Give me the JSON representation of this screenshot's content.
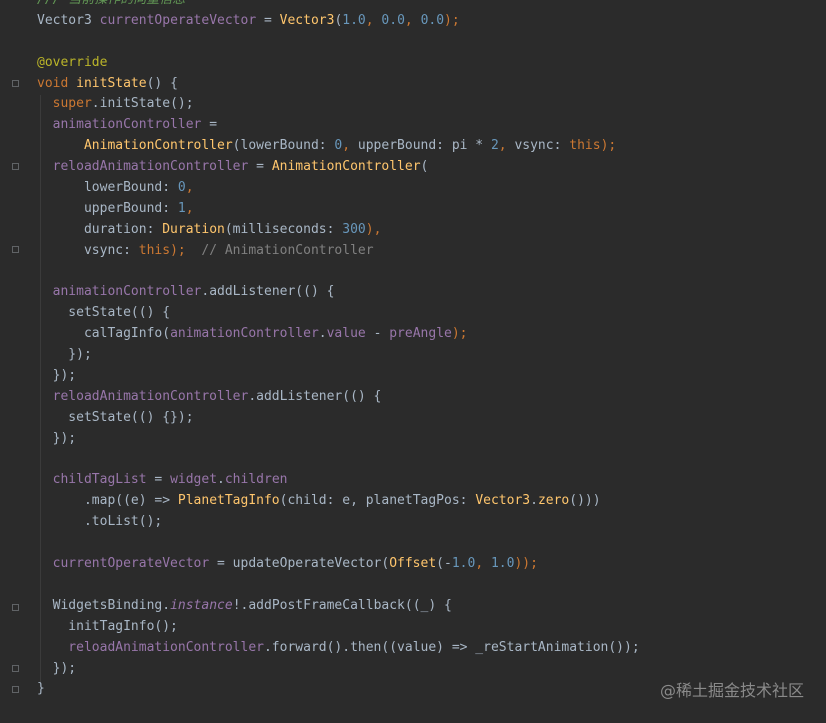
{
  "lines": [
    [
      {
        "t": "/// 当前操作的向量信息",
        "c": "c-comment"
      }
    ],
    [
      {
        "t": "Vector3 ",
        "c": "plain"
      },
      {
        "t": "currentOperateVector",
        "c": "field"
      },
      {
        "t": " = ",
        "c": "plain"
      },
      {
        "t": "Vector3",
        "c": "cls"
      },
      {
        "t": "(",
        "c": "plain"
      },
      {
        "t": "1.0",
        "c": "num"
      },
      {
        "t": ", ",
        "c": "kw"
      },
      {
        "t": "0.0",
        "c": "num"
      },
      {
        "t": ", ",
        "c": "kw"
      },
      {
        "t": "0.0",
        "c": "num"
      },
      {
        "t": ");",
        "c": "kw"
      }
    ],
    [],
    [
      {
        "t": "@override",
        "c": "ann"
      }
    ],
    [
      {
        "t": "void ",
        "c": "kw"
      },
      {
        "t": "initState",
        "c": "fn"
      },
      {
        "t": "() {",
        "c": "plain"
      }
    ],
    [
      {
        "t": "  super",
        "c": "kw"
      },
      {
        "t": ".initState();",
        "c": "plain"
      }
    ],
    [
      {
        "t": "  animationController",
        "c": "field"
      },
      {
        "t": " =",
        "c": "plain"
      }
    ],
    [
      {
        "t": "      AnimationController",
        "c": "cls"
      },
      {
        "t": "(lowerBound: ",
        "c": "plain"
      },
      {
        "t": "0",
        "c": "num"
      },
      {
        "t": ", ",
        "c": "kw"
      },
      {
        "t": "upperBound: pi * ",
        "c": "plain"
      },
      {
        "t": "2",
        "c": "num"
      },
      {
        "t": ", ",
        "c": "kw"
      },
      {
        "t": "vsync: ",
        "c": "plain"
      },
      {
        "t": "this",
        "c": "kw"
      },
      {
        "t": ");",
        "c": "kw"
      }
    ],
    [
      {
        "t": "  reloadAnimationController",
        "c": "field"
      },
      {
        "t": " = ",
        "c": "plain"
      },
      {
        "t": "AnimationController",
        "c": "cls"
      },
      {
        "t": "(",
        "c": "plain"
      }
    ],
    [
      {
        "t": "      lowerBound: ",
        "c": "plain"
      },
      {
        "t": "0",
        "c": "num"
      },
      {
        "t": ",",
        "c": "kw"
      }
    ],
    [
      {
        "t": "      upperBound: ",
        "c": "plain"
      },
      {
        "t": "1",
        "c": "num"
      },
      {
        "t": ",",
        "c": "kw"
      }
    ],
    [
      {
        "t": "      duration: ",
        "c": "plain"
      },
      {
        "t": "Duration",
        "c": "cls"
      },
      {
        "t": "(milliseconds: ",
        "c": "plain"
      },
      {
        "t": "300",
        "c": "num"
      },
      {
        "t": "),",
        "c": "kw"
      }
    ],
    [
      {
        "t": "      vsync: ",
        "c": "plain"
      },
      {
        "t": "this",
        "c": "kw"
      },
      {
        "t": ");",
        "c": "kw"
      },
      {
        "t": "  // AnimationController",
        "c": "c-comment2"
      }
    ],
    [],
    [
      {
        "t": "  animationController",
        "c": "field"
      },
      {
        "t": ".addListener(() {",
        "c": "plain"
      }
    ],
    [
      {
        "t": "    setState(() {",
        "c": "plain"
      }
    ],
    [
      {
        "t": "      calTagInfo(",
        "c": "plain"
      },
      {
        "t": "animationController",
        "c": "field"
      },
      {
        "t": ".",
        "c": "plain"
      },
      {
        "t": "value",
        "c": "field"
      },
      {
        "t": " - ",
        "c": "plain"
      },
      {
        "t": "preAngle",
        "c": "field"
      },
      {
        "t": ");",
        "c": "kw"
      }
    ],
    [
      {
        "t": "    });",
        "c": "plain"
      }
    ],
    [
      {
        "t": "  });",
        "c": "plain"
      }
    ],
    [
      {
        "t": "  reloadAnimationController",
        "c": "field"
      },
      {
        "t": ".addListener(() {",
        "c": "plain"
      }
    ],
    [
      {
        "t": "    setState(() {});",
        "c": "plain"
      }
    ],
    [
      {
        "t": "  });",
        "c": "plain"
      }
    ],
    [],
    [
      {
        "t": "  childTagList",
        "c": "field"
      },
      {
        "t": " = ",
        "c": "plain"
      },
      {
        "t": "widget",
        "c": "field"
      },
      {
        "t": ".",
        "c": "plain"
      },
      {
        "t": "children",
        "c": "field"
      }
    ],
    [
      {
        "t": "      .map((e) => ",
        "c": "plain"
      },
      {
        "t": "PlanetTagInfo",
        "c": "cls"
      },
      {
        "t": "(child: e, planetTagPos: ",
        "c": "plain"
      },
      {
        "t": "Vector3",
        "c": "cls"
      },
      {
        "t": ".",
        "c": "plain"
      },
      {
        "t": "zero",
        "c": "fn"
      },
      {
        "t": "()))",
        "c": "plain"
      }
    ],
    [
      {
        "t": "      .toList();",
        "c": "plain"
      }
    ],
    [],
    [
      {
        "t": "  currentOperateVector",
        "c": "field"
      },
      {
        "t": " = updateOperateVector(",
        "c": "plain"
      },
      {
        "t": "Offset",
        "c": "cls"
      },
      {
        "t": "(-",
        "c": "plain"
      },
      {
        "t": "1.0",
        "c": "num"
      },
      {
        "t": ", ",
        "c": "kw"
      },
      {
        "t": "1.0",
        "c": "num"
      },
      {
        "t": "));",
        "c": "kw"
      }
    ],
    [],
    [
      {
        "t": "  WidgetsBinding.",
        "c": "plain"
      },
      {
        "t": "instance",
        "c": "italic"
      },
      {
        "t": "!.addPostFrameCallback((_) {",
        "c": "plain"
      }
    ],
    [
      {
        "t": "    initTagInfo();",
        "c": "plain"
      }
    ],
    [
      {
        "t": "    reloadAnimationController",
        "c": "field"
      },
      {
        "t": ".forward().then((value) => _reStartAnimation());",
        "c": "plain"
      }
    ],
    [
      {
        "t": "  });",
        "c": "plain"
      }
    ],
    [
      {
        "t": "}",
        "c": "plain"
      }
    ]
  ],
  "watermark": "@稀土掘金技术社区"
}
